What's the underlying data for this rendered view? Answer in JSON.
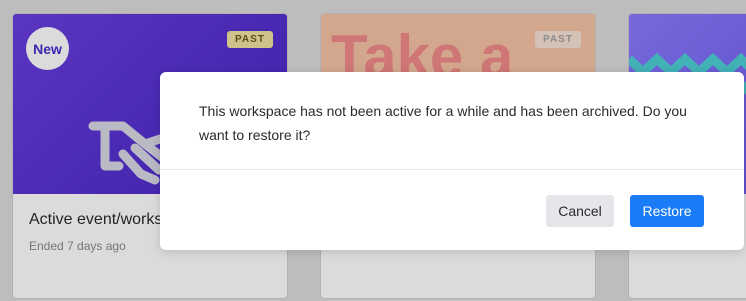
{
  "cards": [
    {
      "badge_new": "New",
      "badge_past": "PAST",
      "title": "Active event/works",
      "subtitle": "Ended 7 days ago"
    },
    {
      "badge_past": "PAST",
      "image_text": "Take a"
    },
    {}
  ],
  "dialog": {
    "message": "This workspace has not been active for a while and has been archived. Do you want to restore it?",
    "cancel_label": "Cancel",
    "restore_label": "Restore"
  },
  "colors": {
    "primary": "#1a7cf6",
    "card1_thumb": "#5530d0",
    "card2_thumb": "#f6c3a6"
  }
}
